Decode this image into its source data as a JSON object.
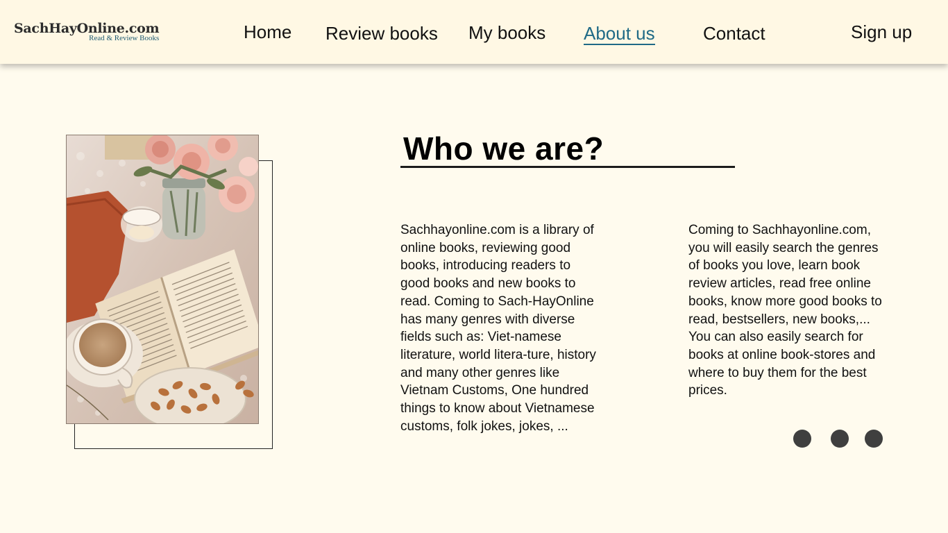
{
  "brand": {
    "name": "SachHayOnline.com",
    "tagline": "Read & Review Books"
  },
  "nav": {
    "items": [
      {
        "label": "Home",
        "active": false
      },
      {
        "label": "Review books",
        "active": false
      },
      {
        "label": "My books",
        "active": false
      },
      {
        "label": "About us",
        "active": true
      },
      {
        "label": "Contact",
        "active": false
      }
    ],
    "signup_label": "Sign up"
  },
  "about": {
    "title": "Who we are?",
    "paragraph_1": "Sachhayonline.com is a library of online books, reviewing good books, introducing readers to good books and new books to read. Coming to Sach-HayOnline has many genres with diverse fields such as: Viet-namese literature, world litera-ture, history and many other genres like Vietnam Customs, One hundred things to know about Vietnamese customs, folk jokes, jokes, ...",
    "paragraph_2": "Coming to Sachhayonline.com, you will easily search the genres of books you love, learn book review articles, read free online books, know more good books to read, bestsellers, new books,... You can also easily search for books at online book-stores and where to buy them for the best prices."
  },
  "carousel": {
    "dot_count": 3
  },
  "colors": {
    "background": "#fffbee",
    "header_background": "#fff8e4",
    "accent": "#1f6a86",
    "dot": "#3f3f3f"
  },
  "icons": {
    "photo": "books-coffee-photo"
  }
}
